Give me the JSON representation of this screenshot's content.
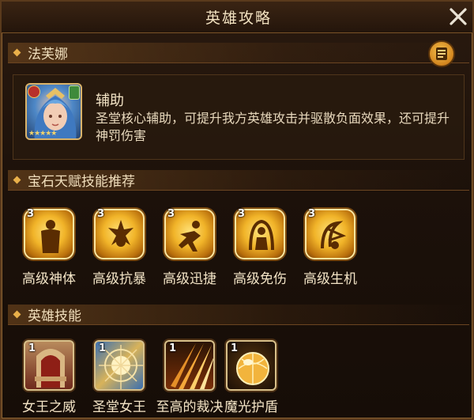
{
  "window": {
    "title": "英雄攻略"
  },
  "hero": {
    "name": "法芙娜",
    "role": "辅助",
    "description": "圣堂核心辅助，可提升我方英雄攻击并驱散负面效果，还可提升神罚伤害",
    "stars": "★★★★★"
  },
  "talents": {
    "title": "宝石天赋技能推荐",
    "items": [
      {
        "level": "3",
        "label": "高级神体",
        "icon": "body-icon"
      },
      {
        "level": "3",
        "label": "高级抗暴",
        "icon": "burst-icon"
      },
      {
        "level": "3",
        "label": "高级迅捷",
        "icon": "swift-icon"
      },
      {
        "level": "3",
        "label": "高级免伤",
        "icon": "shield-figure-icon"
      },
      {
        "level": "3",
        "label": "高级生机",
        "icon": "vitality-icon"
      }
    ]
  },
  "skills": {
    "title": "英雄技能",
    "items": [
      {
        "level": "1",
        "label": "女王之威",
        "icon": "throne-icon"
      },
      {
        "level": "1",
        "label": "圣堂女王",
        "icon": "stained-glass-icon"
      },
      {
        "level": "1",
        "label": "至高的裁决",
        "icon": "light-rays-icon"
      },
      {
        "level": "1",
        "label": "魔光护盾",
        "icon": "orb-shield-icon"
      }
    ]
  },
  "colors": {
    "accent": "#e9b04a",
    "panel": "#1c110a",
    "text": "#f3e4c6"
  }
}
